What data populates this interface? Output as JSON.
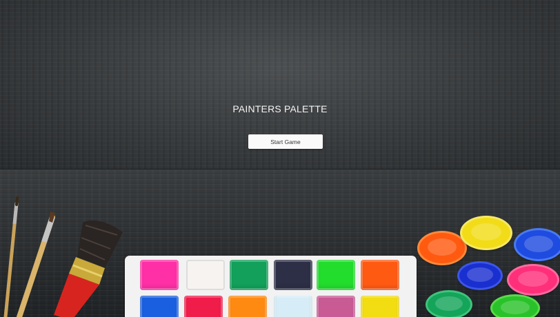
{
  "game": {
    "title": "PAINTERS PALETTE",
    "start_button": "Start Game"
  },
  "palette_colors": {
    "top_row": [
      "#ff2fa6",
      "#f7f3f0",
      "#12a05a",
      "#2c2f45",
      "#22dd2c",
      "#ff5a12"
    ],
    "bottom_row": [
      "#1a5fe0",
      "#f01c4a",
      "#ff8a12",
      "#d6ecf6",
      "#c85a94",
      "#f2dc12"
    ]
  },
  "paint_pots": [
    "#ff5a10",
    "#f2dc18",
    "#1e4be0",
    "#1a2fd0",
    "#ff2f7a",
    "#14a45a",
    "#2ac22a"
  ]
}
